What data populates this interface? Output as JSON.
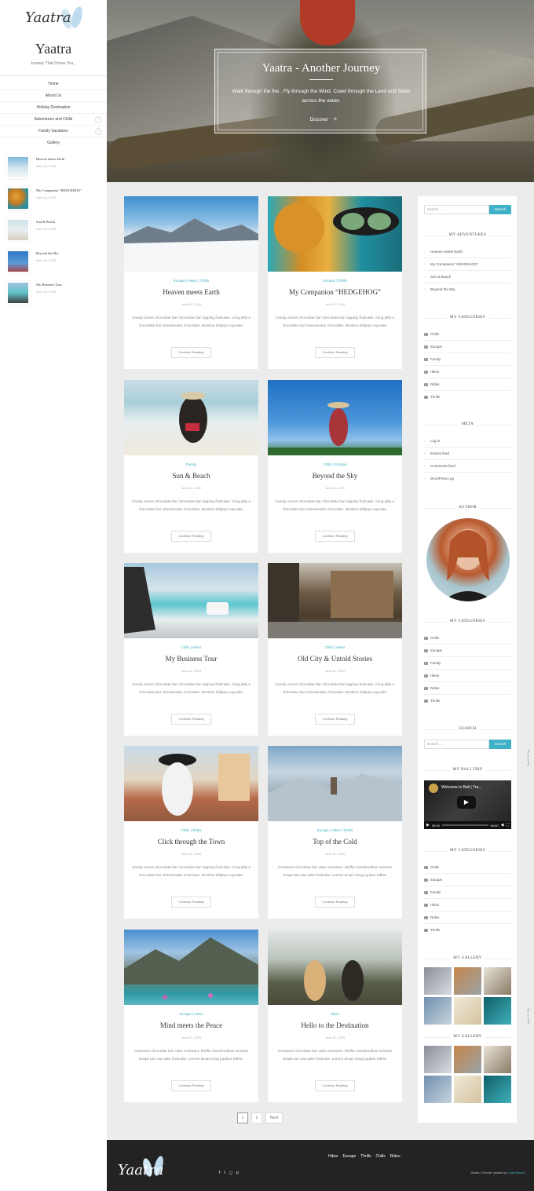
{
  "site": {
    "title": "Yaatra",
    "tagline": "Journey That Drives You...",
    "logo_text": "Yaatra"
  },
  "nav": [
    {
      "label": "Home",
      "expand": false
    },
    {
      "label": "About Us",
      "expand": false
    },
    {
      "label": "Holiday Destination",
      "expand": false
    },
    {
      "label": "Adventures and Chills",
      "expand": true
    },
    {
      "label": "Family Vacations",
      "expand": true
    },
    {
      "label": "Gallery",
      "expand": false
    }
  ],
  "recent": [
    {
      "title": "Heaven meets Earth",
      "date": "June 11, 2019"
    },
    {
      "title": "My Companion \"HEDGEHOG\"",
      "date": "June 11, 2019"
    },
    {
      "title": "Sun & Beach",
      "date": "June 11, 2019"
    },
    {
      "title": "Beyond the Sky",
      "date": "June 11, 2019"
    },
    {
      "title": "My Business Tour",
      "date": "June 11, 2019"
    }
  ],
  "hero": {
    "title": "Yaatra - Another Journey",
    "desc": "Walk through the fire , Fly through the Wind, Crawl through the Land and Swim across the water.",
    "discover": "Discover"
  },
  "posts": [
    {
      "cats": "Escape | Hikes | Thrills",
      "title": "Heaven meets Earth",
      "date": "June 11, 2019",
      "excerpt": "Candy canes chocolate bar chocolate bar topping fruitcake. Icing jelly-o chocolate bar cheesecake chocolate. Bonbon lollipop cupcake.",
      "btn": "Continue Reading"
    },
    {
      "cats": "Escape | Thrills",
      "title": "My Companion “HEDGEHOG”",
      "date": "June 11, 2019",
      "excerpt": "Candy canes chocolate bar chocolate bar topping fruitcake. Icing jelly-o chocolate bar cheesecake chocolate. Bonbon lollipop cupcake.",
      "btn": "Continue Reading"
    },
    {
      "cats": "Family",
      "title": "Sun & Beach",
      "date": "June 11, 2019",
      "excerpt": "Candy canes chocolate bar chocolate bar topping fruitcake. Icing jelly-o chocolate bar cheesecake chocolate. Bonbon lollipop cupcake.",
      "btn": "Continue Reading"
    },
    {
      "cats": "Chills | Escape",
      "title": "Beyond the Sky",
      "date": "June 11, 2019",
      "excerpt": "Candy canes chocolate bar chocolate bar topping fruitcake. Icing jelly-o chocolate bar cheesecake chocolate. Bonbon lollipop cupcake.",
      "btn": "Continue Reading"
    },
    {
      "cats": "Chills | Hikes",
      "title": "My Business Tour",
      "date": "June 11, 2019",
      "excerpt": "Candy canes chocolate bar chocolate bar topping fruitcake. Icing jelly-o chocolate bar cheesecake chocolate. Bonbon lollipop cupcake.",
      "btn": "Continue Reading"
    },
    {
      "cats": "Chills | Hikes",
      "title": "Old City & Untold Stories",
      "date": "June 11, 2019",
      "excerpt": "Candy canes chocolate bar chocolate bar topping fruitcake. Icing jelly-o chocolate bar cheesecake chocolate. Bonbon lollipop cupcake.",
      "btn": "Continue Reading"
    },
    {
      "cats": "Chills | Rides",
      "title": "Click through the Town",
      "date": "June 11, 2019",
      "excerpt": "Candy canes chocolate bar chocolate bar topping fruitcake. Icing jelly-o chocolate bar cheesecake chocolate. Bonbon lollipop cupcake.",
      "btn": "Continue Reading"
    },
    {
      "cats": "Escape | Hikes | Thrills",
      "title": "Top of the Cold",
      "date": "June 11, 2019",
      "excerpt": "Croissant chocolate bar cake croissant. Muffin marshmallow sesame snaps tart oat cake fruitcake. Lemon drops icing jujubes toffee.",
      "btn": "Continue Reading"
    },
    {
      "cats": "Escape | Hikes",
      "title": "Mind meets the Peace",
      "date": "June 11, 2019",
      "excerpt": "Croissant chocolate bar cake croissant. Muffin marshmallow sesame snaps tart oat cake fruitcake. Lemon drops icing jujubes toffee.",
      "btn": "Continue Reading"
    },
    {
      "cats": "Hikes",
      "title": "Hello to the Destination",
      "date": "June 11, 2019",
      "excerpt": "Croissant chocolate bar cake croissant. Muffin marshmallow sesame snaps tart oat cake fruitcake. Lemon drops icing jujubes toffee.",
      "btn": "Continue Reading"
    }
  ],
  "pagination": {
    "pages": [
      "1",
      "2"
    ],
    "next": "Next"
  },
  "sidebar": {
    "search_placeholder": "Search ...",
    "search_button": "Search",
    "adventures_title": "MY ADVENTURES",
    "adventures": [
      "Heaven meets Earth",
      "My Companion \"HEDGEHOG\"",
      "Sun & Beach",
      "Beyond the Sky"
    ],
    "categories_title": "MY CATEGORIES",
    "categories": [
      "Chills",
      "Escape",
      "Family",
      "Hikes",
      "Rides",
      "Thrills"
    ],
    "meta_title": "META",
    "meta": [
      "Log in",
      "Entries feed",
      "Comments feed",
      "WordPress.org"
    ],
    "author_title": "AUTHOR",
    "search_title": "SEARCH",
    "bali_title": "MY BALI TRIP",
    "video_title": "Welcome to Bali | Tra...",
    "video_time": "00:00",
    "video_dur": "00:00",
    "gallery_title": "MY GALLERY"
  },
  "footer": {
    "nav": [
      "Hikes",
      "Escape",
      "Thrills",
      "Chills",
      "Rides"
    ],
    "credits_prefix": "Yaatra | Theme: yaatra by",
    "credits_link": "CodeVibrant"
  },
  "back_to_top": "Back To Top"
}
